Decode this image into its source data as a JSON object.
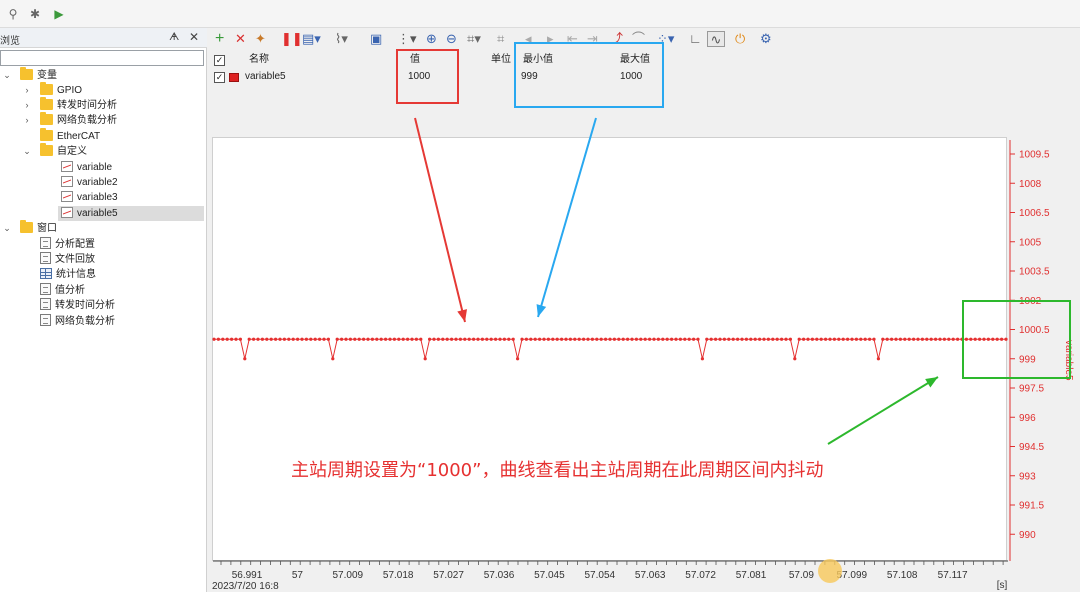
{
  "top_toolbar": {
    "icons": [
      "link-icon",
      "settings-icon",
      "play-icon"
    ]
  },
  "left_panel": {
    "title": "浏览",
    "pin": "ᗗ",
    "close": "✕",
    "tree": {
      "variables_root": "变量",
      "gpio": "GPIO",
      "forward_time": "转发时间分析",
      "network_load": "网络负载分析",
      "ethercat": "EtherCAT",
      "custom": "自定义",
      "var1": "variable",
      "var2": "variable2",
      "var3": "variable3",
      "var5": "variable5",
      "windows_root": "窗口",
      "analysis_config": "分析配置",
      "file_replay": "文件回放",
      "statistics": "统计信息",
      "value_analysis": "值分析",
      "forward_time_win": "转发时间分析",
      "network_load_win": "网络负载分析"
    }
  },
  "legend": {
    "col_name": "名称",
    "col_value": "值",
    "col_unit": "单位",
    "col_min": "最小值",
    "col_max": "最大值",
    "row": {
      "name": "variable5",
      "value": "1000",
      "unit": "",
      "min": "999",
      "max": "1000"
    }
  },
  "annotation": {
    "text": "主站周期设置为“1000”，曲线查看出主站周期在此周期区间内抖动",
    "red": "#e53935",
    "blue": "#29a8f0",
    "green": "#2db82d"
  },
  "chart_data": {
    "type": "line",
    "series": [
      {
        "name": "variable5",
        "color": "#e53030"
      }
    ],
    "y_ticks": [
      "1009.5",
      "1008",
      "1006.5",
      "1005",
      "1003.5",
      "1002",
      "1000.5",
      "999",
      "997.5",
      "996",
      "994.5",
      "993",
      "991.5",
      "990"
    ],
    "x_ticks": [
      "56.991",
      "57",
      "57.009",
      "57.018",
      "57.027",
      "57.036",
      "57.045",
      "57.054",
      "57.063",
      "57.072",
      "57.081",
      "57.09",
      "57.099",
      "57.108",
      "57.117"
    ],
    "x_unit": "[s]",
    "x_date": "2023/7/20 16:8",
    "ylim": [
      989,
      1010
    ],
    "baseline": 1000,
    "dip_value": 999,
    "dip_positions": [
      56.9905,
      57.0062,
      57.0228,
      57.039,
      57.0727,
      57.0885,
      57.104
    ]
  }
}
